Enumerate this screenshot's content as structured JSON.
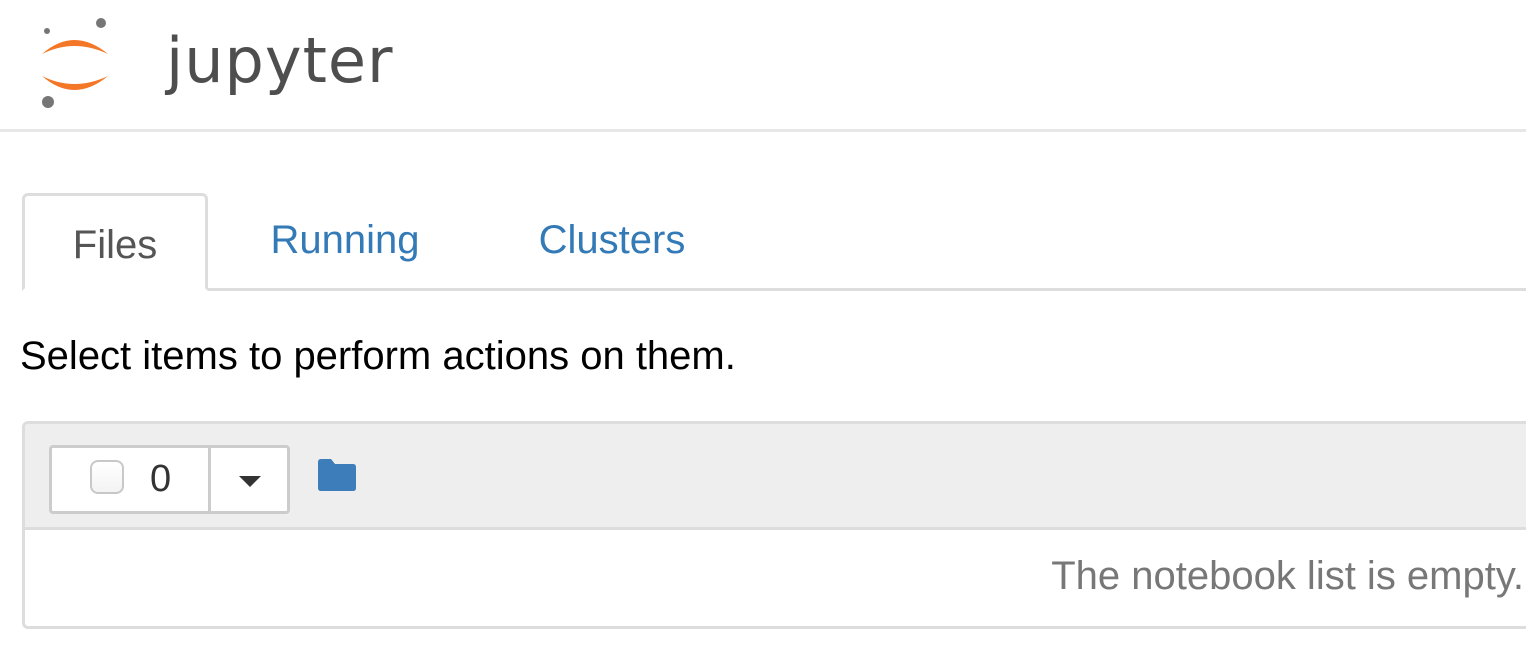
{
  "app": {
    "logo_text": "jupyter"
  },
  "tabs": [
    {
      "label": "Files",
      "active": true
    },
    {
      "label": "Running",
      "active": false
    },
    {
      "label": "Clusters",
      "active": false
    }
  ],
  "hint_text": "Select items to perform actions on them.",
  "toolbar": {
    "selected_count": "0"
  },
  "list": {
    "empty_message": "The notebook list is empty."
  },
  "icons": {
    "folder": "folder-icon",
    "caret": "caret-down-icon",
    "logo": "jupyter-logo-icon"
  },
  "colors": {
    "logo_orange": "#f37726",
    "logo_gray": "#767677",
    "link_blue": "#337ab7",
    "folder_blue": "#3d7dba"
  }
}
